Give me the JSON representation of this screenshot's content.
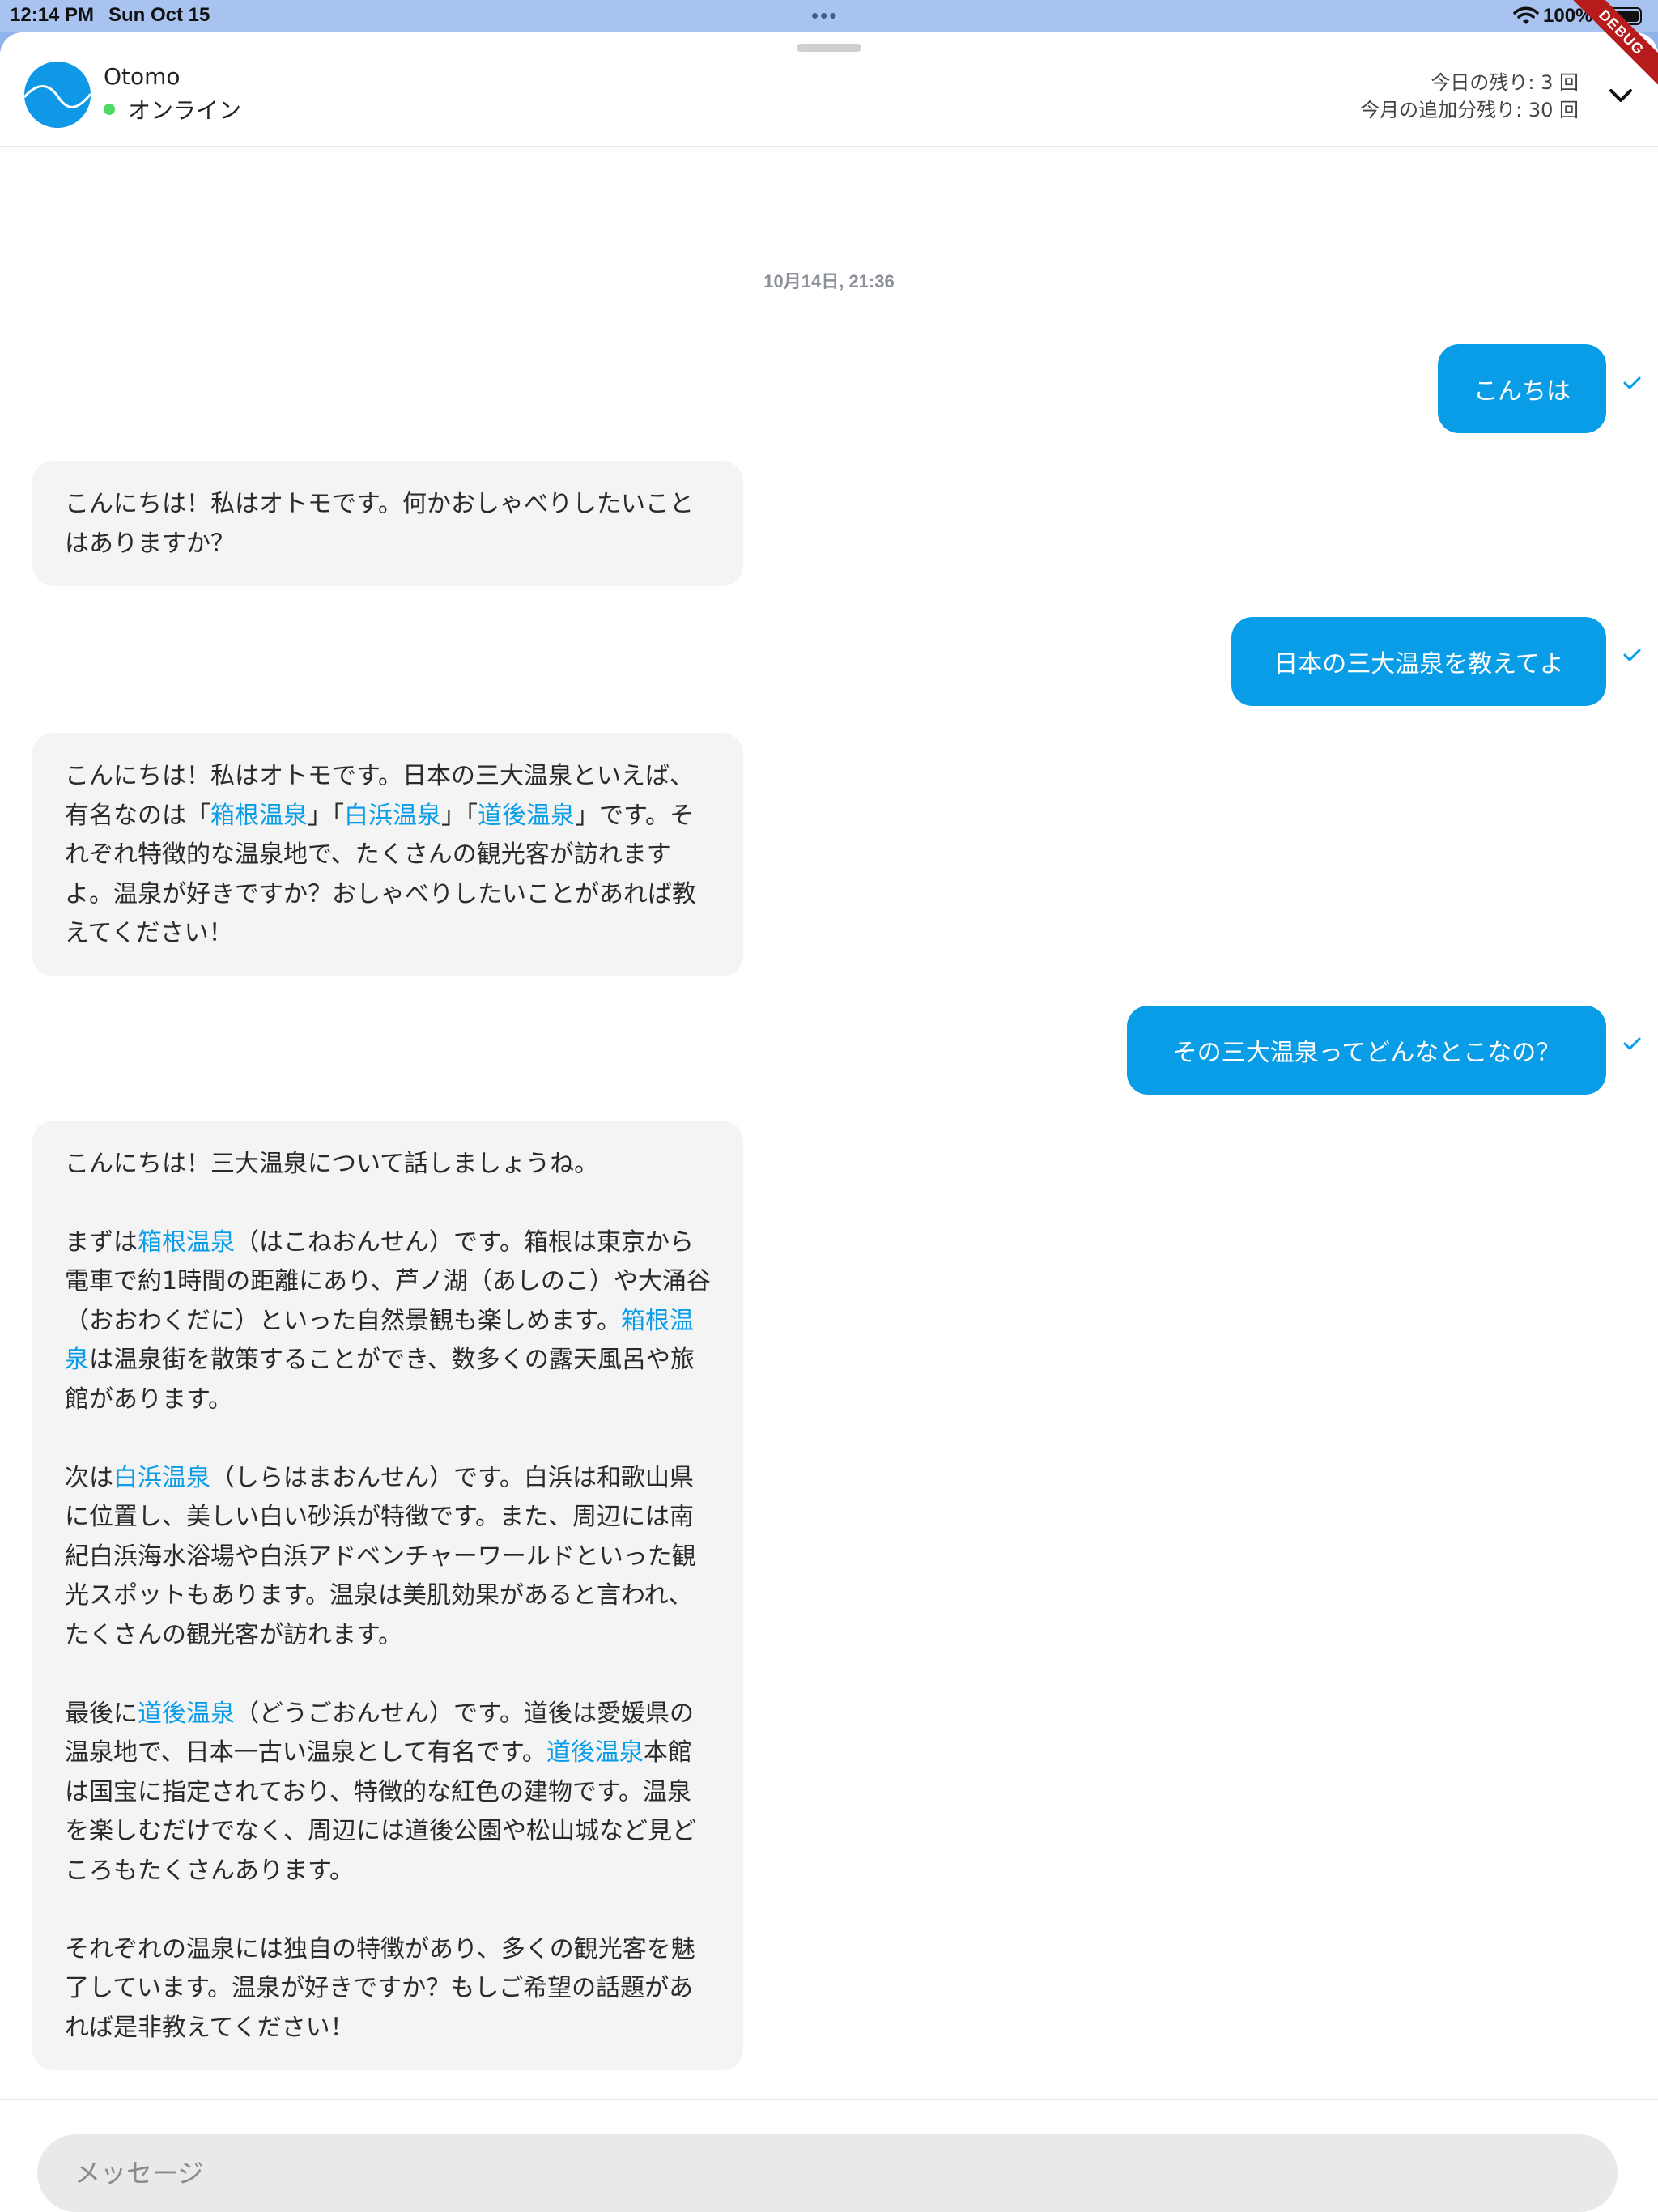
{
  "status_bar": {
    "time": "12:14 PM",
    "date": "Sun Oct 15",
    "battery": "100%",
    "debug_banner": "DEBUG"
  },
  "header": {
    "name": "Otomo",
    "status": "オンライン",
    "quota_today": "今日の残り: 3 回",
    "quota_month": "今月の追加分残り: 30 回"
  },
  "chat": {
    "date_separator": "10月14日, 21:36",
    "messages": [
      {
        "role": "user",
        "text": "こんちは"
      },
      {
        "role": "bot",
        "text": "こんにちは！私はオトモです。何かおしゃべりしたいことはありますか？"
      },
      {
        "role": "user",
        "text": "日本の三大温泉を教えてよ"
      },
      {
        "role": "bot",
        "segments": [
          "こんにちは！私はオトモです。日本の三大温泉といえば、有名なのは「",
          "箱根温泉",
          "」「",
          "白浜温泉",
          "」「",
          "道後温泉",
          "」です。それぞれ特徴的な温泉地で、たくさんの観光客が訪れますよ。温泉が好きですか？おしゃべりしたいことがあれば教えてください！"
        ]
      },
      {
        "role": "user",
        "text": "その三大温泉ってどんなとこなの？"
      },
      {
        "role": "bot",
        "p1": "こんにちは！三大温泉について話しましょうね。",
        "p2": [
          "まずは",
          "箱根温泉",
          "（はこねおんせん）です。箱根は東京から電車で約1時間の距離にあり、芦ノ湖（あしのこ）や大涌谷（おおわくだに）といった自然景観も楽しめます。",
          "箱根温泉",
          "は温泉街を散策することができ、数多くの露天風呂や旅館があります。"
        ],
        "p3": [
          "次は",
          "白浜温泉",
          "（しらはまおんせん）です。白浜は和歌山県に位置し、美しい白い砂浜が特徴です。また、周辺には南紀白浜海水浴場や白浜アドベンチャーワールドといった観光スポットもあります。温泉は美肌効果があると言われ、たくさんの観光客が訪れます。"
        ],
        "p4": [
          "最後に",
          "道後温泉",
          "（どうごおんせん）です。道後は愛媛県の温泉地で、日本一古い温泉として有名です。",
          "道後温泉",
          "本館は国宝に指定されており、特徴的な紅色の建物です。温泉を楽しむだけでなく、周辺には道後公園や松山城など見どころもたくさんあります。"
        ],
        "p5": "それぞれの温泉には独自の特徴があり、多くの観光客を魅了しています。温泉が好きですか？もしご希望の話題があれば是非教えてください！"
      }
    ]
  },
  "composer": {
    "placeholder": "メッセージ"
  },
  "colors": {
    "accent": "#0a9de7",
    "online": "#4cd964",
    "bot_bubble": "#f4f4f4"
  }
}
